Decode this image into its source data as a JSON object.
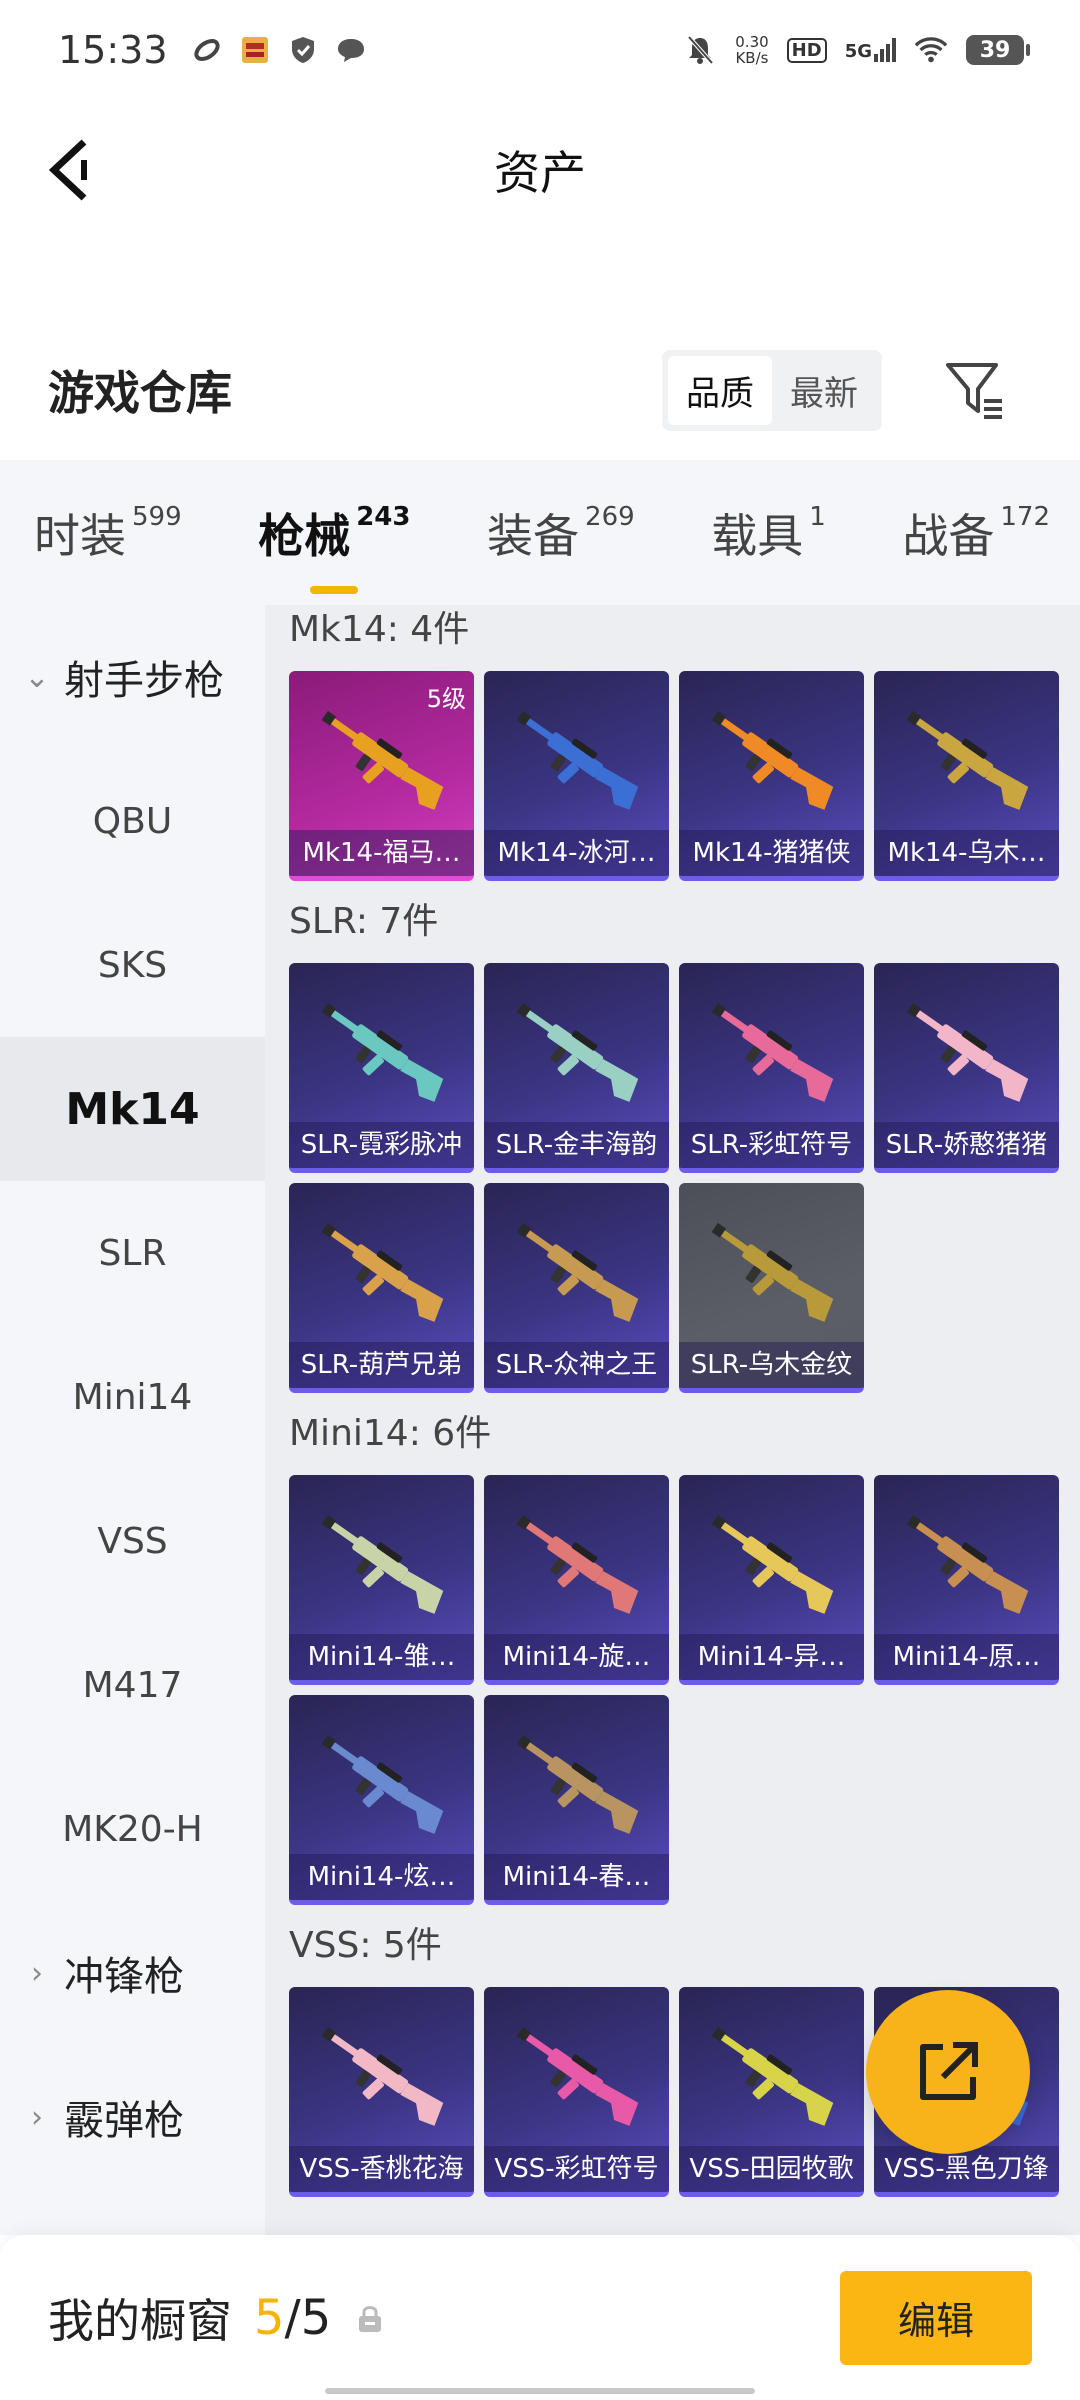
{
  "status_bar": {
    "time": "15:33",
    "net_speed_value": "0.30",
    "net_speed_unit": "KB/s",
    "hd_badge": "HD",
    "signal": "5G",
    "battery": "39"
  },
  "header": {
    "title": "资产"
  },
  "warehouse": {
    "title": "游戏仓库",
    "sort_options": [
      "品质",
      "最新"
    ],
    "active_sort": "品质"
  },
  "category_tabs": [
    {
      "label": "时装",
      "count": "599"
    },
    {
      "label": "枪械",
      "count": "243"
    },
    {
      "label": "装备",
      "count": "269"
    },
    {
      "label": "载具",
      "count": "1"
    },
    {
      "label": "战备",
      "count": "172"
    }
  ],
  "sidebar": {
    "group_marksman": "射手步枪",
    "items": [
      "QBU",
      "SKS",
      "Mk14",
      "SLR",
      "Mini14",
      "VSS",
      "M417",
      "MK20-H"
    ],
    "group_smg": "冲锋枪",
    "group_shotgun": "霰弹枪",
    "active": "Mk14"
  },
  "sections": [
    {
      "title": "Mk14: 4件",
      "items": [
        {
          "label": "Mk14-福马…",
          "level": "5级",
          "rarity": "pink",
          "gun_color": "#e8a020"
        },
        {
          "label": "Mk14-冰河…",
          "rarity": "purple",
          "gun_color": "#3b6fd4"
        },
        {
          "label": "Mk14-猪猪侠",
          "rarity": "purple",
          "gun_color": "#f08a24"
        },
        {
          "label": "Mk14-乌木…",
          "rarity": "purple",
          "gun_color": "#c9a640"
        }
      ]
    },
    {
      "title": "SLR: 7件",
      "items": [
        {
          "label": "SLR-霓彩脉冲",
          "rarity": "purple",
          "gun_color": "#6ac8c0"
        },
        {
          "label": "SLR-金丰海韵",
          "rarity": "purple",
          "gun_color": "#9ad0c4"
        },
        {
          "label": "SLR-彩虹符号",
          "rarity": "purple",
          "gun_color": "#e86a9a"
        },
        {
          "label": "SLR-娇憨猪猪",
          "rarity": "purple",
          "gun_color": "#f2b6c8"
        },
        {
          "label": "SLR-葫芦兄弟",
          "rarity": "purple",
          "gun_color": "#d9a24a"
        },
        {
          "label": "SLR-众神之王",
          "rarity": "purple",
          "gun_color": "#c79a52"
        },
        {
          "label": "SLR-乌木金纹",
          "rarity": "gray",
          "gun_color": "#b89a3a"
        }
      ]
    },
    {
      "title": "Mini14: 6件",
      "items": [
        {
          "label": "Mini14-雏…",
          "rarity": "purple",
          "gun_color": "#c8d4a8"
        },
        {
          "label": "Mini14-旋…",
          "rarity": "purple",
          "gun_color": "#e07878"
        },
        {
          "label": "Mini14-异…",
          "rarity": "purple",
          "gun_color": "#e6c85a"
        },
        {
          "label": "Mini14-原…",
          "rarity": "purple",
          "gun_color": "#c89050"
        },
        {
          "label": "Mini14-炫…",
          "rarity": "purple",
          "gun_color": "#6a8ad0"
        },
        {
          "label": "Mini14-春…",
          "rarity": "purple",
          "gun_color": "#b89460"
        }
      ]
    },
    {
      "title": "VSS: 5件",
      "items": [
        {
          "label": "VSS-香桃花海",
          "rarity": "purple",
          "gun_color": "#f2b8c6"
        },
        {
          "label": "VSS-彩虹符号",
          "rarity": "purple",
          "gun_color": "#e85aa8"
        },
        {
          "label": "VSS-田园牧歌",
          "rarity": "purple",
          "gun_color": "#d8d44a"
        },
        {
          "label": "VSS-黑色刀锋",
          "rarity": "purple",
          "gun_color": "#3a6ad8"
        }
      ]
    }
  ],
  "bottom_bar": {
    "window_label": "我的橱窗",
    "window_used": "5",
    "window_total": "/5",
    "edit_label": "编辑"
  },
  "colors": {
    "accent": "#f5b400",
    "card_purple": "#3b3584",
    "card_pink": "#b42aa0"
  }
}
